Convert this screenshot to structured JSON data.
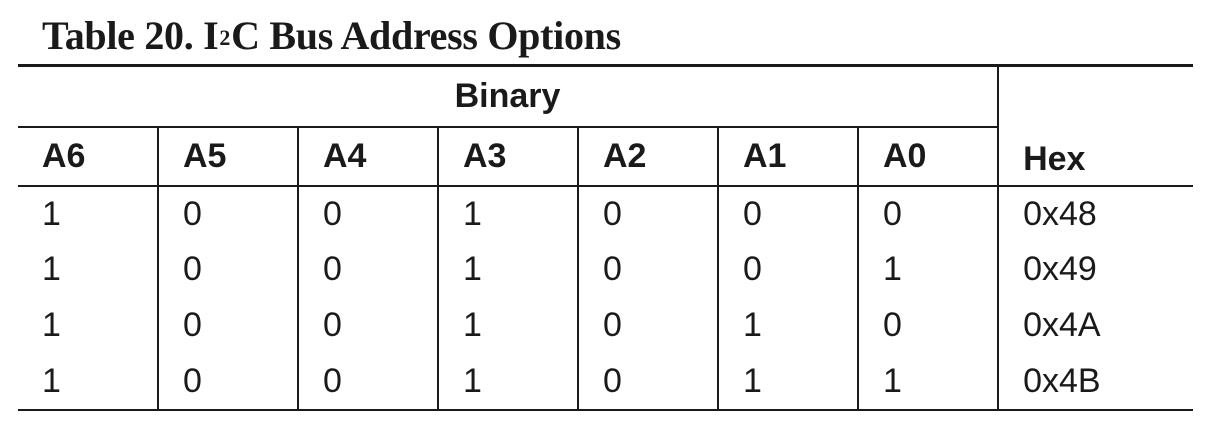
{
  "caption": {
    "prefix": "Table 20. I",
    "superscript": "2",
    "suffix": "C Bus Address Options"
  },
  "table": {
    "group_header": "Binary",
    "hex_header": "Hex",
    "columns": [
      "A6",
      "A5",
      "A4",
      "A3",
      "A2",
      "A1",
      "A0"
    ],
    "rows": [
      {
        "bits": [
          "1",
          "0",
          "0",
          "1",
          "0",
          "0",
          "0"
        ],
        "hex": "0x48"
      },
      {
        "bits": [
          "1",
          "0",
          "0",
          "1",
          "0",
          "0",
          "1"
        ],
        "hex": "0x49"
      },
      {
        "bits": [
          "1",
          "0",
          "0",
          "1",
          "0",
          "1",
          "0"
        ],
        "hex": "0x4A"
      },
      {
        "bits": [
          "1",
          "0",
          "0",
          "1",
          "0",
          "1",
          "1"
        ],
        "hex": "0x4B"
      }
    ]
  }
}
